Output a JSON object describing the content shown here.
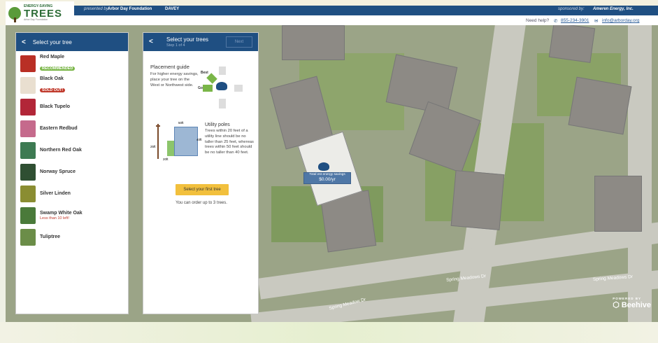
{
  "header": {
    "logo_small": "ENERGY-SAVING",
    "logo_big": "TREES",
    "logo_tagline": "Arbor Day Foundation",
    "presented_by": "presented by:",
    "arbor_partner": "Arbor Day Foundation",
    "davey_partner": "DAVEY",
    "sponsored_by": "sponsored by:",
    "sponsor_name": "Ameren Energy, Inc.",
    "help_label": "Need help?",
    "phone": "855-234-3901",
    "email": "info@arborday.org"
  },
  "left_panel": {
    "title": "Select your tree",
    "trees": [
      {
        "name": "Red Maple",
        "badge": "RECOMMENDED",
        "badge_color": "#7ab648",
        "thumb": "#b92f25"
      },
      {
        "name": "Black Oak",
        "badge": "SOLD OUT!",
        "badge_color": "#c0392b",
        "thumb": "#e9dfd0"
      },
      {
        "name": "Black Tupelo",
        "thumb": "#b22638"
      },
      {
        "name": "Eastern Redbud",
        "thumb": "#c56a8c"
      },
      {
        "name": "Northern Red Oak",
        "thumb": "#3d7a52"
      },
      {
        "name": "Norway Spruce",
        "thumb": "#2f4f32"
      },
      {
        "name": "Silver Linden",
        "thumb": "#8a8d32"
      },
      {
        "name": "Swamp White Oak",
        "warning": "Less than 10 left!",
        "thumb": "#4a7a3a"
      },
      {
        "name": "Tuliptree",
        "thumb": "#6b8d48"
      }
    ]
  },
  "middle_panel": {
    "title": "Select your trees",
    "step": "Step 1 of 4",
    "next": "Next",
    "placement": {
      "heading": "Placement guide",
      "text": "For higher energy savings, place your tree on the West or Northwest side.",
      "best": "Best",
      "good": "Good"
    },
    "utility": {
      "heading": "Utility poles",
      "text": "Trees within 20 feet of a utility line should be no taller than 25 feet, whereas trees within 50 feet should be no taller than 40 feet.",
      "dim_top": "50ft",
      "dim_left": "25ft",
      "dim_right": "40ft",
      "dim_bottom": "20ft"
    },
    "cta": "Select your first tree",
    "note": "You can order up to 3 trees."
  },
  "map": {
    "savings_label": "Total est energy savings",
    "savings_value": "$0.00/yr",
    "street_1": "Spring Meadows Dr",
    "street_2": "Spring Meadow Dr",
    "street_3": "Spring Meadows Dr",
    "powered_by": "POWERED BY",
    "brand": "Beehive"
  }
}
